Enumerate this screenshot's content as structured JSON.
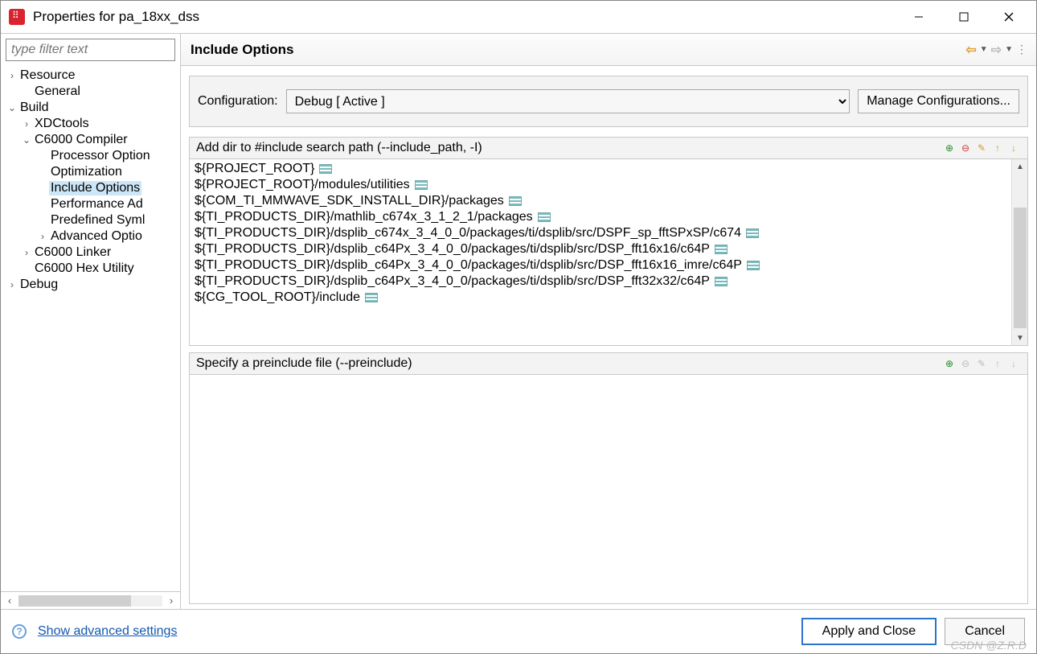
{
  "window": {
    "title": "Properties for pa_18xx_dss"
  },
  "sidebar": {
    "filter_placeholder": "type filter text",
    "items": [
      {
        "label": "Resource",
        "depth": 0,
        "twisty": "›",
        "selected": false
      },
      {
        "label": "General",
        "depth": 1,
        "twisty": "",
        "selected": false
      },
      {
        "label": "Build",
        "depth": 0,
        "twisty": "⌄",
        "selected": false
      },
      {
        "label": "XDCtools",
        "depth": 1,
        "twisty": "›",
        "selected": false
      },
      {
        "label": "C6000 Compiler",
        "depth": 1,
        "twisty": "⌄",
        "selected": false
      },
      {
        "label": "Processor Option",
        "depth": 2,
        "twisty": "",
        "selected": false
      },
      {
        "label": "Optimization",
        "depth": 2,
        "twisty": "",
        "selected": false
      },
      {
        "label": "Include Options",
        "depth": 2,
        "twisty": "",
        "selected": true
      },
      {
        "label": "Performance Ad",
        "depth": 2,
        "twisty": "",
        "selected": false
      },
      {
        "label": "Predefined Syml",
        "depth": 2,
        "twisty": "",
        "selected": false
      },
      {
        "label": "Advanced Optio",
        "depth": 2,
        "twisty": "›",
        "selected": false
      },
      {
        "label": "C6000 Linker",
        "depth": 1,
        "twisty": "›",
        "selected": false
      },
      {
        "label": "C6000 Hex Utility",
        "depth": 1,
        "twisty": "",
        "selected": false
      },
      {
        "label": "Debug",
        "depth": 0,
        "twisty": "›",
        "selected": false
      }
    ]
  },
  "main": {
    "heading": "Include Options",
    "config_label": "Configuration:",
    "config_value": "Debug  [ Active ]",
    "manage_btn": "Manage Configurations...",
    "include_title": "Add dir to #include search path (--include_path, -I)",
    "include_paths": [
      "${PROJECT_ROOT}",
      "${PROJECT_ROOT}/modules/utilities",
      "${COM_TI_MMWAVE_SDK_INSTALL_DIR}/packages",
      "${TI_PRODUCTS_DIR}/mathlib_c674x_3_1_2_1/packages",
      "${TI_PRODUCTS_DIR}/dsplib_c674x_3_4_0_0/packages/ti/dsplib/src/DSPF_sp_fftSPxSP/c674",
      "${TI_PRODUCTS_DIR}/dsplib_c64Px_3_4_0_0/packages/ti/dsplib/src/DSP_fft16x16/c64P",
      "${TI_PRODUCTS_DIR}/dsplib_c64Px_3_4_0_0/packages/ti/dsplib/src/DSP_fft16x16_imre/c64P",
      "${TI_PRODUCTS_DIR}/dsplib_c64Px_3_4_0_0/packages/ti/dsplib/src/DSP_fft32x32/c64P",
      "${CG_TOOL_ROOT}/include"
    ],
    "preinclude_title": "Specify a preinclude file (--preinclude)"
  },
  "footer": {
    "advanced_link": "Show advanced settings",
    "apply_btn": "Apply and Close",
    "cancel_btn": "Cancel"
  },
  "watermark": "CSDN @Z.R.D"
}
